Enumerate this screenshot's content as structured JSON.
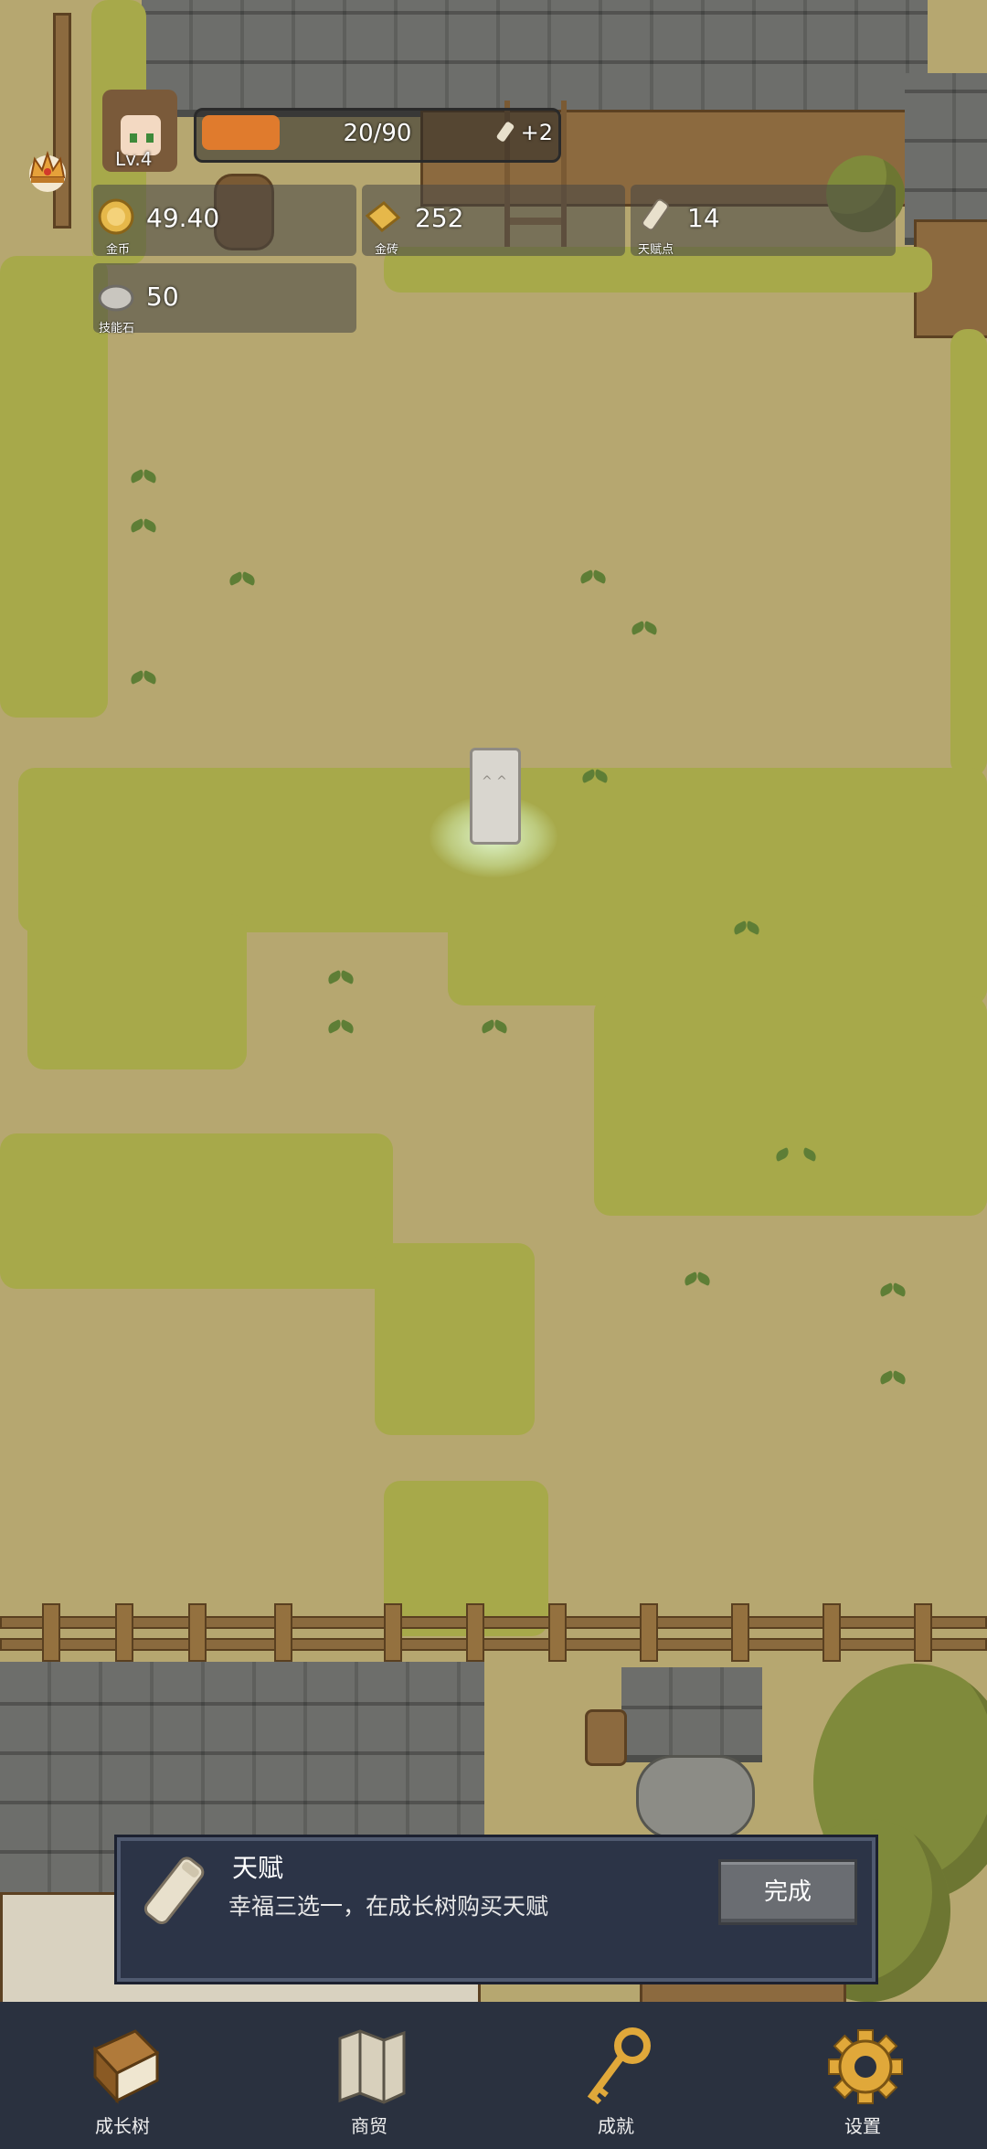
{
  "player": {
    "level_label": "Lv.4"
  },
  "xp": {
    "current_label": "20/90",
    "bonus_label": "+2",
    "progress": 0.222
  },
  "resources": [
    {
      "id": "coins",
      "value": "49.40",
      "label": "金币",
      "icon": "gold-coin-icon"
    },
    {
      "id": "gold_bricks",
      "value": "252",
      "label": "金砖",
      "icon": "gold-brick-icon"
    },
    {
      "id": "talent_points",
      "value": "14",
      "label": "天赋点",
      "icon": "scroll-icon"
    },
    {
      "id": "skill_stones",
      "value": "50",
      "label": "技能石",
      "icon": "stone-icon"
    }
  ],
  "toast": {
    "title": "天赋",
    "description": "幸福三选一，在成长树购买天赋",
    "button_label": "完成",
    "icon": "scroll-icon"
  },
  "nav": [
    {
      "label": "成长树",
      "icon": "book-icon"
    },
    {
      "label": "商贸",
      "icon": "map-icon"
    },
    {
      "label": "成就",
      "icon": "key-icon"
    },
    {
      "label": "设置",
      "icon": "gear-icon"
    }
  ],
  "colors": {
    "dirt": "#b6a770",
    "grass": "#a7a94a",
    "xp_fill": "#e07b2d",
    "toast_bg": "#2c3447",
    "nav_bg": "#2a313f",
    "button_bg": "#6a6d72"
  }
}
